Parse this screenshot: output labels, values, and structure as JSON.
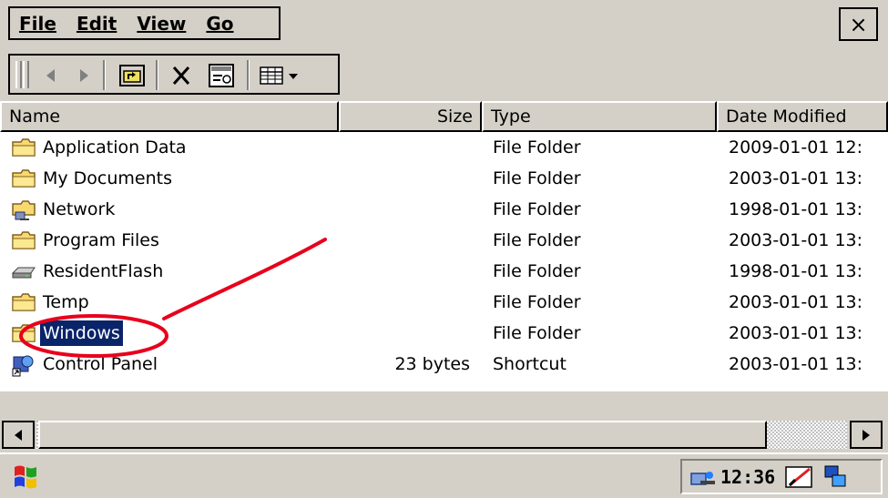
{
  "menu": {
    "items": [
      {
        "label": "File"
      },
      {
        "label": "Edit"
      },
      {
        "label": "View"
      },
      {
        "label": "Go"
      }
    ],
    "close_glyph": "×"
  },
  "toolbar": {
    "buttons": [
      {
        "icon": "back-arrow-icon"
      },
      {
        "icon": "forward-arrow-icon"
      },
      {
        "icon": "up-folder-icon"
      },
      {
        "icon": "delete-icon"
      },
      {
        "icon": "properties-icon"
      },
      {
        "icon": "view-menu-icon"
      }
    ]
  },
  "columns": {
    "name": "Name",
    "size": "Size",
    "type": "Type",
    "date": "Date Modified"
  },
  "files": [
    {
      "name": "Application Data",
      "size": "",
      "type": "File Folder",
      "date": "2009-01-01 12:",
      "icon": "folder-icon",
      "selected": false
    },
    {
      "name": "My Documents",
      "size": "",
      "type": "File Folder",
      "date": "2003-01-01 13:",
      "icon": "folder-icon",
      "selected": false
    },
    {
      "name": "Network",
      "size": "",
      "type": "File Folder",
      "date": "1998-01-01 13:",
      "icon": "network-icon",
      "selected": false
    },
    {
      "name": "Program Files",
      "size": "",
      "type": "File Folder",
      "date": "2003-01-01 13:",
      "icon": "folder-icon",
      "selected": false
    },
    {
      "name": "ResidentFlash",
      "size": "",
      "type": "File Folder",
      "date": "1998-01-01 13:",
      "icon": "drive-icon",
      "selected": false
    },
    {
      "name": "Temp",
      "size": "",
      "type": "File Folder",
      "date": "2003-01-01 13:",
      "icon": "folder-icon",
      "selected": false
    },
    {
      "name": "Windows",
      "size": "",
      "type": "File Folder",
      "date": "2003-01-01 13:",
      "icon": "folder-icon",
      "selected": true
    },
    {
      "name": "Control Panel",
      "size": "23 bytes",
      "type": "Shortcut",
      "date": "2003-01-01 13:",
      "icon": "control-panel-icon",
      "selected": false
    }
  ],
  "taskbar": {
    "clock": "12:36",
    "start_icon": "windows-logo-icon",
    "tray_icons": [
      "network-connection-icon",
      "pen-input-icon",
      "desktop-switch-icon"
    ]
  },
  "colors": {
    "selection": "#0a246a",
    "annotation": "#e8001c",
    "chrome": "#d4d0c8"
  }
}
